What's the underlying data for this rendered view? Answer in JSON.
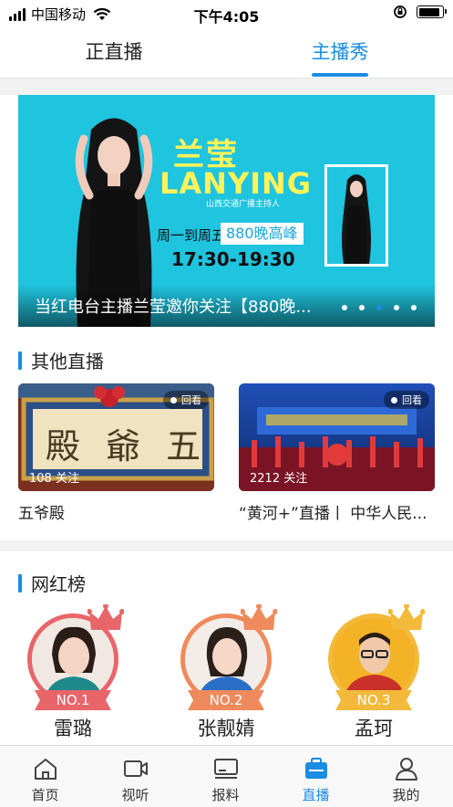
{
  "status_bar": {
    "carrier": "中国移动",
    "time": "下午4:05",
    "battery_level": 0.9
  },
  "top_tabs": [
    {
      "label": "正直播",
      "active": false
    },
    {
      "label": "主播秀",
      "active": true
    }
  ],
  "banner": {
    "name_cn": "兰莹",
    "name_en": "LANYING",
    "role": "山西交通广播主持人",
    "days": "周一到周五",
    "show": "880晚高峰",
    "time": "17:30-19:30",
    "caption": "当红电台主播兰莹邀你关注【880晚...",
    "dots": 5,
    "active_dot": 2
  },
  "other_live": {
    "title": "其他直播",
    "cards": [
      {
        "title": "五爷殿",
        "viewers": "108 关注",
        "badge": "回看",
        "thumb_text": "殿 爺 五"
      },
      {
        "title": "“黄河+”直播丨 中华人民...",
        "viewers": "2212 关注",
        "badge": "回看"
      }
    ]
  },
  "ranking": {
    "title": "网红榜",
    "items": [
      {
        "rank": "NO.1",
        "name": "雷璐"
      },
      {
        "rank": "NO.2",
        "name": "张靓婧"
      },
      {
        "rank": "NO.3",
        "name": "孟珂"
      }
    ]
  },
  "bottom_nav": [
    {
      "label": "首页",
      "icon": "home-icon",
      "active": false
    },
    {
      "label": "视听",
      "icon": "video-icon",
      "active": false
    },
    {
      "label": "报料",
      "icon": "report-icon",
      "active": false
    },
    {
      "label": "直播",
      "icon": "live-icon",
      "active": true
    },
    {
      "label": "我的",
      "icon": "profile-icon",
      "active": false
    }
  ],
  "colors": {
    "accent": "#1a8ce3",
    "banner_bg": "#1fc4de",
    "rank1": "#e8656a",
    "rank2": "#ef8a5c",
    "rank3": "#f3b93a"
  }
}
